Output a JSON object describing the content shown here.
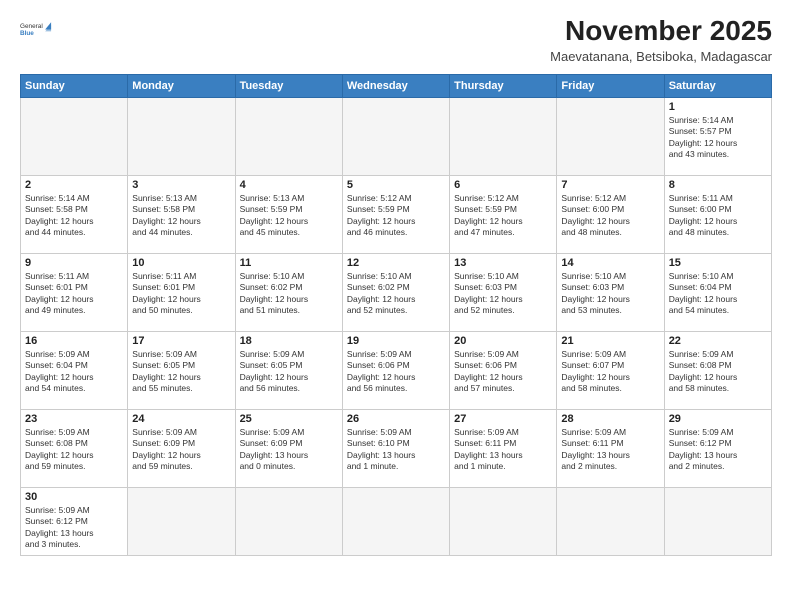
{
  "header": {
    "logo_general": "General",
    "logo_blue": "Blue",
    "month_year": "November 2025",
    "location": "Maevatanana, Betsiboka, Madagascar"
  },
  "days_of_week": [
    "Sunday",
    "Monday",
    "Tuesday",
    "Wednesday",
    "Thursday",
    "Friday",
    "Saturday"
  ],
  "weeks": [
    [
      {
        "day": "",
        "info": ""
      },
      {
        "day": "",
        "info": ""
      },
      {
        "day": "",
        "info": ""
      },
      {
        "day": "",
        "info": ""
      },
      {
        "day": "",
        "info": ""
      },
      {
        "day": "",
        "info": ""
      },
      {
        "day": "1",
        "info": "Sunrise: 5:14 AM\nSunset: 5:57 PM\nDaylight: 12 hours\nand 43 minutes."
      }
    ],
    [
      {
        "day": "2",
        "info": "Sunrise: 5:14 AM\nSunset: 5:58 PM\nDaylight: 12 hours\nand 44 minutes."
      },
      {
        "day": "3",
        "info": "Sunrise: 5:13 AM\nSunset: 5:58 PM\nDaylight: 12 hours\nand 44 minutes."
      },
      {
        "day": "4",
        "info": "Sunrise: 5:13 AM\nSunset: 5:59 PM\nDaylight: 12 hours\nand 45 minutes."
      },
      {
        "day": "5",
        "info": "Sunrise: 5:12 AM\nSunset: 5:59 PM\nDaylight: 12 hours\nand 46 minutes."
      },
      {
        "day": "6",
        "info": "Sunrise: 5:12 AM\nSunset: 5:59 PM\nDaylight: 12 hours\nand 47 minutes."
      },
      {
        "day": "7",
        "info": "Sunrise: 5:12 AM\nSunset: 6:00 PM\nDaylight: 12 hours\nand 48 minutes."
      },
      {
        "day": "8",
        "info": "Sunrise: 5:11 AM\nSunset: 6:00 PM\nDaylight: 12 hours\nand 48 minutes."
      }
    ],
    [
      {
        "day": "9",
        "info": "Sunrise: 5:11 AM\nSunset: 6:01 PM\nDaylight: 12 hours\nand 49 minutes."
      },
      {
        "day": "10",
        "info": "Sunrise: 5:11 AM\nSunset: 6:01 PM\nDaylight: 12 hours\nand 50 minutes."
      },
      {
        "day": "11",
        "info": "Sunrise: 5:10 AM\nSunset: 6:02 PM\nDaylight: 12 hours\nand 51 minutes."
      },
      {
        "day": "12",
        "info": "Sunrise: 5:10 AM\nSunset: 6:02 PM\nDaylight: 12 hours\nand 52 minutes."
      },
      {
        "day": "13",
        "info": "Sunrise: 5:10 AM\nSunset: 6:03 PM\nDaylight: 12 hours\nand 52 minutes."
      },
      {
        "day": "14",
        "info": "Sunrise: 5:10 AM\nSunset: 6:03 PM\nDaylight: 12 hours\nand 53 minutes."
      },
      {
        "day": "15",
        "info": "Sunrise: 5:10 AM\nSunset: 6:04 PM\nDaylight: 12 hours\nand 54 minutes."
      }
    ],
    [
      {
        "day": "16",
        "info": "Sunrise: 5:09 AM\nSunset: 6:04 PM\nDaylight: 12 hours\nand 54 minutes."
      },
      {
        "day": "17",
        "info": "Sunrise: 5:09 AM\nSunset: 6:05 PM\nDaylight: 12 hours\nand 55 minutes."
      },
      {
        "day": "18",
        "info": "Sunrise: 5:09 AM\nSunset: 6:05 PM\nDaylight: 12 hours\nand 56 minutes."
      },
      {
        "day": "19",
        "info": "Sunrise: 5:09 AM\nSunset: 6:06 PM\nDaylight: 12 hours\nand 56 minutes."
      },
      {
        "day": "20",
        "info": "Sunrise: 5:09 AM\nSunset: 6:06 PM\nDaylight: 12 hours\nand 57 minutes."
      },
      {
        "day": "21",
        "info": "Sunrise: 5:09 AM\nSunset: 6:07 PM\nDaylight: 12 hours\nand 58 minutes."
      },
      {
        "day": "22",
        "info": "Sunrise: 5:09 AM\nSunset: 6:08 PM\nDaylight: 12 hours\nand 58 minutes."
      }
    ],
    [
      {
        "day": "23",
        "info": "Sunrise: 5:09 AM\nSunset: 6:08 PM\nDaylight: 12 hours\nand 59 minutes."
      },
      {
        "day": "24",
        "info": "Sunrise: 5:09 AM\nSunset: 6:09 PM\nDaylight: 12 hours\nand 59 minutes."
      },
      {
        "day": "25",
        "info": "Sunrise: 5:09 AM\nSunset: 6:09 PM\nDaylight: 13 hours\nand 0 minutes."
      },
      {
        "day": "26",
        "info": "Sunrise: 5:09 AM\nSunset: 6:10 PM\nDaylight: 13 hours\nand 1 minute."
      },
      {
        "day": "27",
        "info": "Sunrise: 5:09 AM\nSunset: 6:11 PM\nDaylight: 13 hours\nand 1 minute."
      },
      {
        "day": "28",
        "info": "Sunrise: 5:09 AM\nSunset: 6:11 PM\nDaylight: 13 hours\nand 2 minutes."
      },
      {
        "day": "29",
        "info": "Sunrise: 5:09 AM\nSunset: 6:12 PM\nDaylight: 13 hours\nand 2 minutes."
      }
    ],
    [
      {
        "day": "30",
        "info": "Sunrise: 5:09 AM\nSunset: 6:12 PM\nDaylight: 13 hours\nand 3 minutes."
      },
      {
        "day": "",
        "info": ""
      },
      {
        "day": "",
        "info": ""
      },
      {
        "day": "",
        "info": ""
      },
      {
        "day": "",
        "info": ""
      },
      {
        "day": "",
        "info": ""
      },
      {
        "day": "",
        "info": ""
      }
    ]
  ]
}
